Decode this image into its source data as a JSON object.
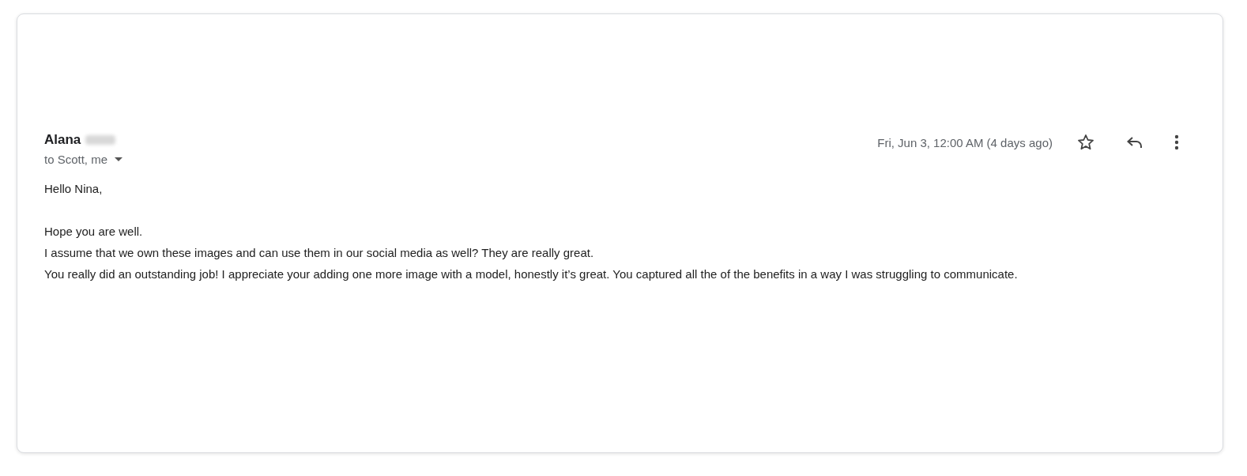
{
  "message": {
    "sender": "Alana",
    "recipients": "to Scott, me",
    "date": "Fri, Jun 3, 12:00 AM (4 days ago)",
    "starred": false,
    "body": [
      {
        "lines": [
          "Hello Nina,"
        ]
      },
      {
        "lines": [
          "Hope you are well.",
          "I assume that we own these images and can use them in our social media as well? They are really great.",
          "You really did an outstanding job! I appreciate your adding one more image with a model, honestly it’s great. You captured all the of the benefits in a way I was struggling to communicate."
        ]
      }
    ]
  }
}
